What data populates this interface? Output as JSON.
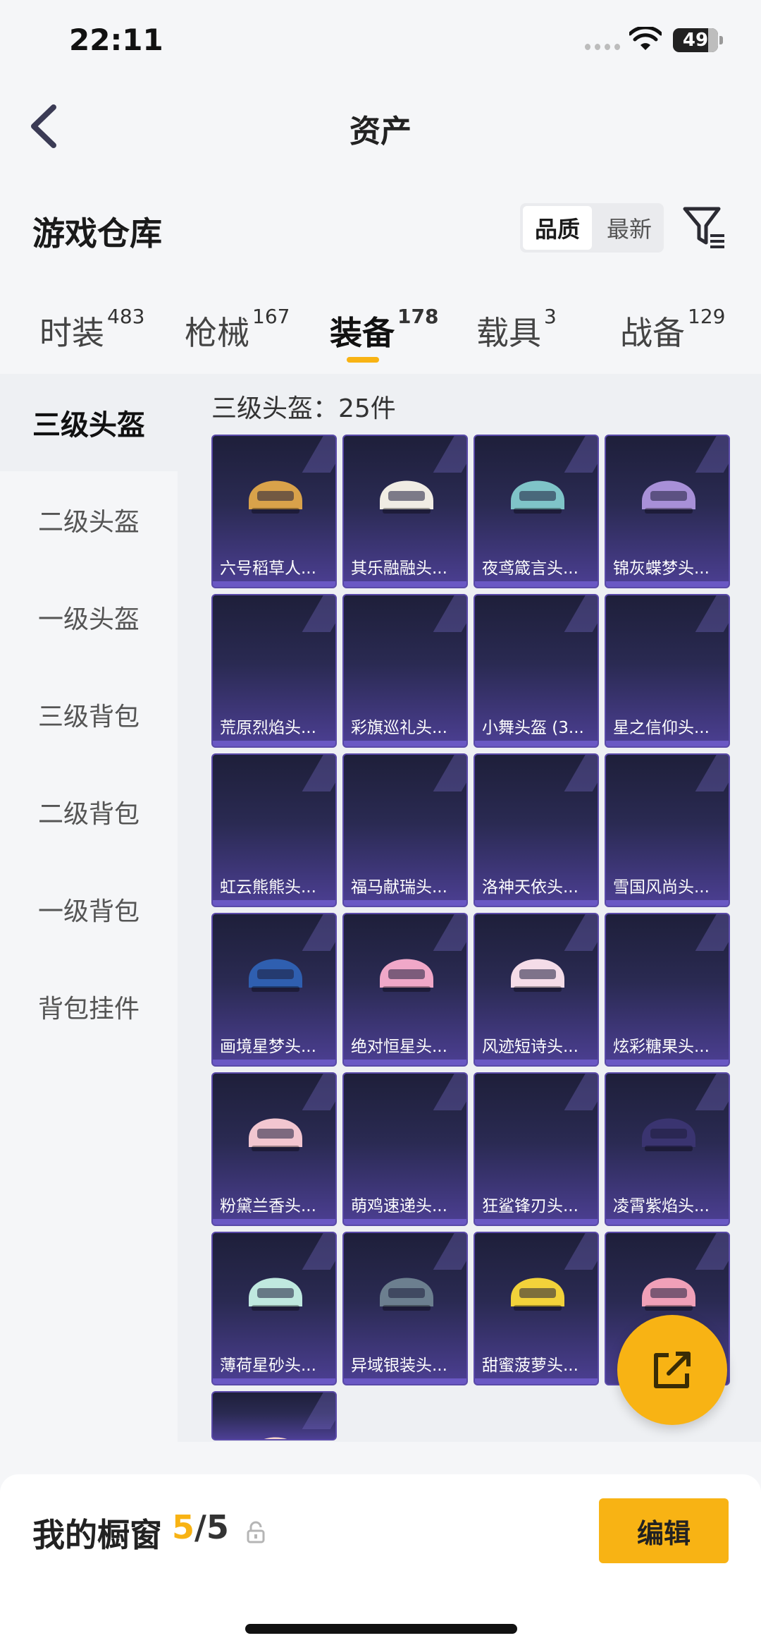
{
  "status_bar": {
    "time": "22:11",
    "battery": "49"
  },
  "nav": {
    "title": "资产",
    "back_icon": "chevron-left-icon"
  },
  "warehouse": {
    "title": "游戏仓库",
    "sort_options": [
      "品质",
      "最新"
    ],
    "active_sort": "品质",
    "filter_icon": "filter-icon"
  },
  "tabs": [
    {
      "label": "时装",
      "count": "483"
    },
    {
      "label": "枪械",
      "count": "167"
    },
    {
      "label": "装备",
      "count": "178"
    },
    {
      "label": "载具",
      "count": "3"
    },
    {
      "label": "战备",
      "count": "129"
    }
  ],
  "active_tab": "装备",
  "sidebar": {
    "items": [
      "三级头盔",
      "二级头盔",
      "一级头盔",
      "三级背包",
      "二级背包",
      "一级背包",
      "背包挂件"
    ],
    "active": "三级头盔"
  },
  "grid": {
    "header": "三级头盔：25件",
    "items": [
      {
        "label": "六号稻草人...",
        "helmet": true,
        "color": "#d9a24a"
      },
      {
        "label": "其乐融融头...",
        "helmet": true,
        "color": "#f0ece4"
      },
      {
        "label": "夜鸢箴言头...",
        "helmet": true,
        "color": "#7fc4c8"
      },
      {
        "label": "锦灰蝶梦头...",
        "helmet": true,
        "color": "#a890d8"
      },
      {
        "label": "荒原烈焰头...",
        "helmet": false
      },
      {
        "label": "彩旗巡礼头...",
        "helmet": false
      },
      {
        "label": "小舞头盔 (3...",
        "helmet": false
      },
      {
        "label": "星之信仰头...",
        "helmet": false
      },
      {
        "label": "虹云熊熊头...",
        "helmet": false
      },
      {
        "label": "福马献瑞头...",
        "helmet": false
      },
      {
        "label": "洛神天依头...",
        "helmet": false
      },
      {
        "label": "雪国风尚头...",
        "helmet": false
      },
      {
        "label": "画境星梦头...",
        "helmet": true,
        "color": "#2f5fb0"
      },
      {
        "label": "绝对恒星头...",
        "helmet": true,
        "color": "#f0a8c8"
      },
      {
        "label": "风迹短诗头...",
        "helmet": true,
        "color": "#f4dce8"
      },
      {
        "label": "炫彩糖果头...",
        "helmet": false
      },
      {
        "label": "粉黛兰香头...",
        "helmet": true,
        "color": "#f2c6d0"
      },
      {
        "label": "萌鸡速递头...",
        "helmet": false
      },
      {
        "label": "狂鲨锋刃头...",
        "helmet": false
      },
      {
        "label": "凌霄紫焰头...",
        "helmet": true,
        "color": "#3a3470"
      },
      {
        "label": "薄荷星砂头...",
        "helmet": true,
        "color": "#bfe8df"
      },
      {
        "label": "异域银装头...",
        "helmet": true,
        "color": "#6c7f8f"
      },
      {
        "label": "甜蜜菠萝头...",
        "helmet": true,
        "color": "#f2d23a"
      },
      {
        "label": "",
        "helmet": true,
        "color": "#f0a0b8"
      },
      {
        "label": "",
        "helmet": true,
        "color": "#f7d6cc"
      }
    ]
  },
  "fab": {
    "icon": "share-icon"
  },
  "showcase": {
    "title": "我的橱窗",
    "current": "5",
    "total": "/5",
    "edit_label": "编辑"
  }
}
